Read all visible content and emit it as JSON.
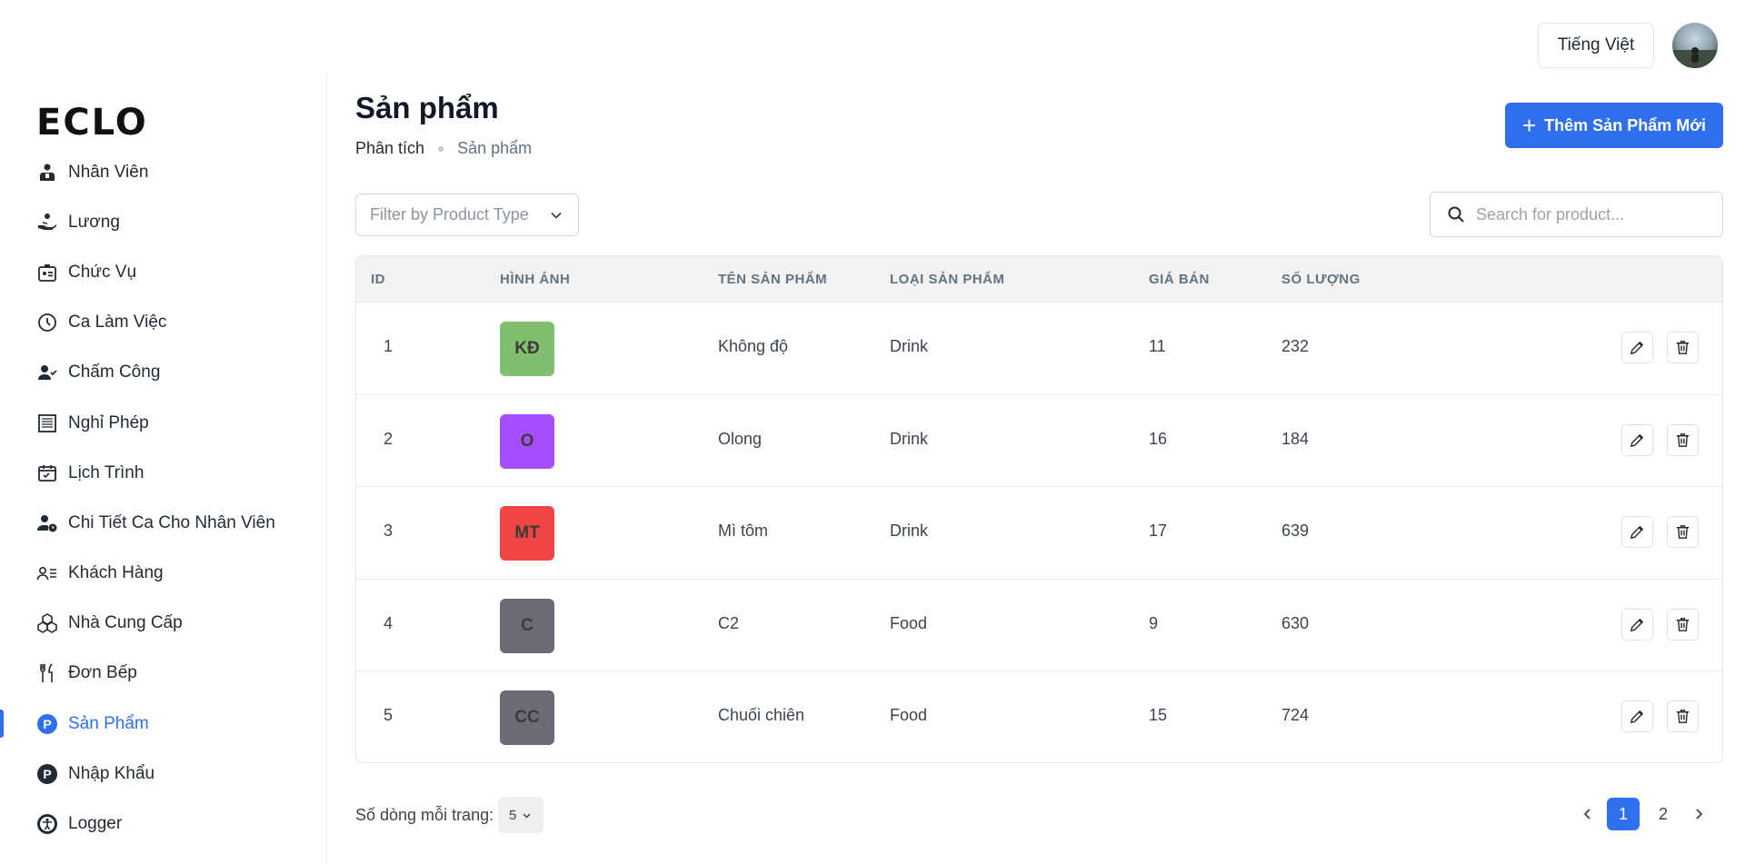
{
  "header": {
    "language_label": "Tiếng Việt"
  },
  "brand": {
    "logo_text": "ECLO"
  },
  "sidebar": {
    "items": [
      {
        "label": "Nhân Viên",
        "icon": "employee-icon"
      },
      {
        "label": "Lương",
        "icon": "salary-icon"
      },
      {
        "label": "Chức Vụ",
        "icon": "position-badge-icon"
      },
      {
        "label": "Ca Làm Việc",
        "icon": "clock-icon"
      },
      {
        "label": "Chấm Công",
        "icon": "user-check-icon"
      },
      {
        "label": "Nghỉ Phép",
        "icon": "leave-document-icon"
      },
      {
        "label": "Lịch Trình",
        "icon": "calendar-check-icon"
      },
      {
        "label": "Chi Tiết Ca Cho Nhân Viên",
        "icon": "user-clock-icon"
      },
      {
        "label": "Khách Hàng",
        "icon": "customer-list-icon"
      },
      {
        "label": "Nhà Cung Cấp",
        "icon": "boxes-icon"
      },
      {
        "label": "Đơn Bếp",
        "icon": "fork-knife-icon"
      },
      {
        "label": "Sản Phẩm",
        "icon": "product-p-icon",
        "active": true
      },
      {
        "label": "Nhập Khẩu",
        "icon": "import-p-icon"
      },
      {
        "label": "Logger",
        "icon": "accessibility-icon"
      }
    ]
  },
  "page": {
    "title": "Sản phẩm",
    "breadcrumb": [
      "Phân tích",
      "Sản phẩm"
    ],
    "add_button_label": "Thêm Sản Phẩm Mới"
  },
  "filters": {
    "product_type_placeholder": "Filter by Product Type",
    "search_placeholder": "Search for product..."
  },
  "table": {
    "columns": [
      "ID",
      "HÌNH ẢNH",
      "TÊN SẢN PHẨM",
      "LOẠI SẢN PHẨM",
      "GIÁ BÁN",
      "SỐ LƯỢNG"
    ],
    "rows": [
      {
        "id": "1",
        "initials": "KĐ",
        "thumb_color": "#7fbf6e",
        "name": "Không độ",
        "type": "Drink",
        "price": "11",
        "qty": "232"
      },
      {
        "id": "2",
        "initials": "O",
        "thumb_color": "#a64dff",
        "name": "Olong",
        "type": "Drink",
        "price": "16",
        "qty": "184"
      },
      {
        "id": "3",
        "initials": "MT",
        "thumb_color": "#ef4444",
        "name": "Mì tôm",
        "type": "Drink",
        "price": "17",
        "qty": "639"
      },
      {
        "id": "4",
        "initials": "C",
        "thumb_color": "#6e6a75",
        "name": "C2",
        "type": "Food",
        "price": "9",
        "qty": "630"
      },
      {
        "id": "5",
        "initials": "CC",
        "thumb_color": "#6e6a75",
        "name": "Chuối chiên",
        "type": "Food",
        "price": "15",
        "qty": "724"
      }
    ]
  },
  "pagination": {
    "rows_per_page_label": "Số dòng mỗi trang:",
    "rows_per_page_value": "5",
    "pages": [
      "1",
      "2"
    ],
    "current_page": "1"
  },
  "colors": {
    "accent": "#2f6fed"
  }
}
